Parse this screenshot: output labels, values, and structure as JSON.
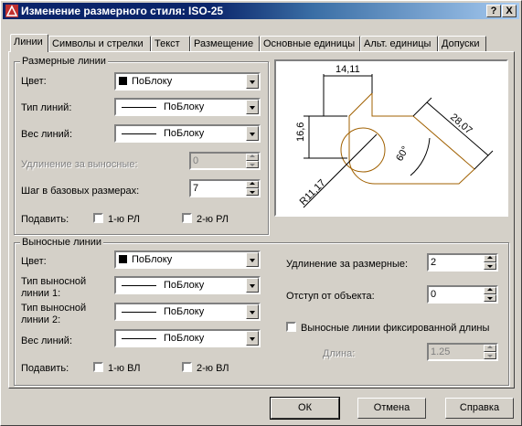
{
  "window": {
    "title": "Изменение размерного стиля: ISO-25",
    "help_btn": "?",
    "close_btn": "X"
  },
  "tabs": [
    {
      "label": "Линии",
      "active": true
    },
    {
      "label": "Символы и стрелки"
    },
    {
      "label": "Текст"
    },
    {
      "label": "Размещение"
    },
    {
      "label": "Основные единицы"
    },
    {
      "label": "Альт. единицы"
    },
    {
      "label": "Допуски"
    }
  ],
  "dim_lines": {
    "title": "Размерные линии",
    "color_label": "Цвет:",
    "color_value": "ПоБлоку",
    "linetype_label": "Тип линий:",
    "linetype_value": "ПоБлоку",
    "lineweight_label": "Вес линий:",
    "lineweight_value": "ПоБлоку",
    "extend_label": "Удлинение за выносные:",
    "extend_value": "0",
    "baseline_label": "Шаг в базовых размерах:",
    "baseline_value": "7",
    "suppress_label": "Подавить:",
    "suppress_1": "1-ю РЛ",
    "suppress_2": "2-ю РЛ"
  },
  "preview": {
    "dim_top": "14,11",
    "dim_left": "16,6",
    "dim_right": "28,07",
    "dim_angle": "60°",
    "dim_radius": "R11,17",
    "accent": "#a06000"
  },
  "ext_lines": {
    "title": "Выносные линии",
    "color_label": "Цвет:",
    "color_value": "ПоБлоку",
    "linetype1_label_a": "Тип выносной",
    "linetype1_label_b": "линии 1:",
    "linetype1_value": "ПоБлоку",
    "linetype2_label_a": "Тип выносной",
    "linetype2_label_b": "линии 2:",
    "linetype2_value": "ПоБлоку",
    "lineweight_label": "Вес линий:",
    "lineweight_value": "ПоБлоку",
    "suppress_label": "Подавить:",
    "suppress_1": "1-ю ВЛ",
    "suppress_2": "2-ю ВЛ",
    "extend_label": "Удлинение за размерные:",
    "extend_value": "2",
    "offset_label": "Отступ от объекта:",
    "offset_value": "0",
    "fixed_label": "Выносные линии фиксированной длины",
    "length_label": "Длина:",
    "length_value": "1.25"
  },
  "buttons": {
    "ok": "ОК",
    "cancel": "Отмена",
    "help": "Справка"
  }
}
